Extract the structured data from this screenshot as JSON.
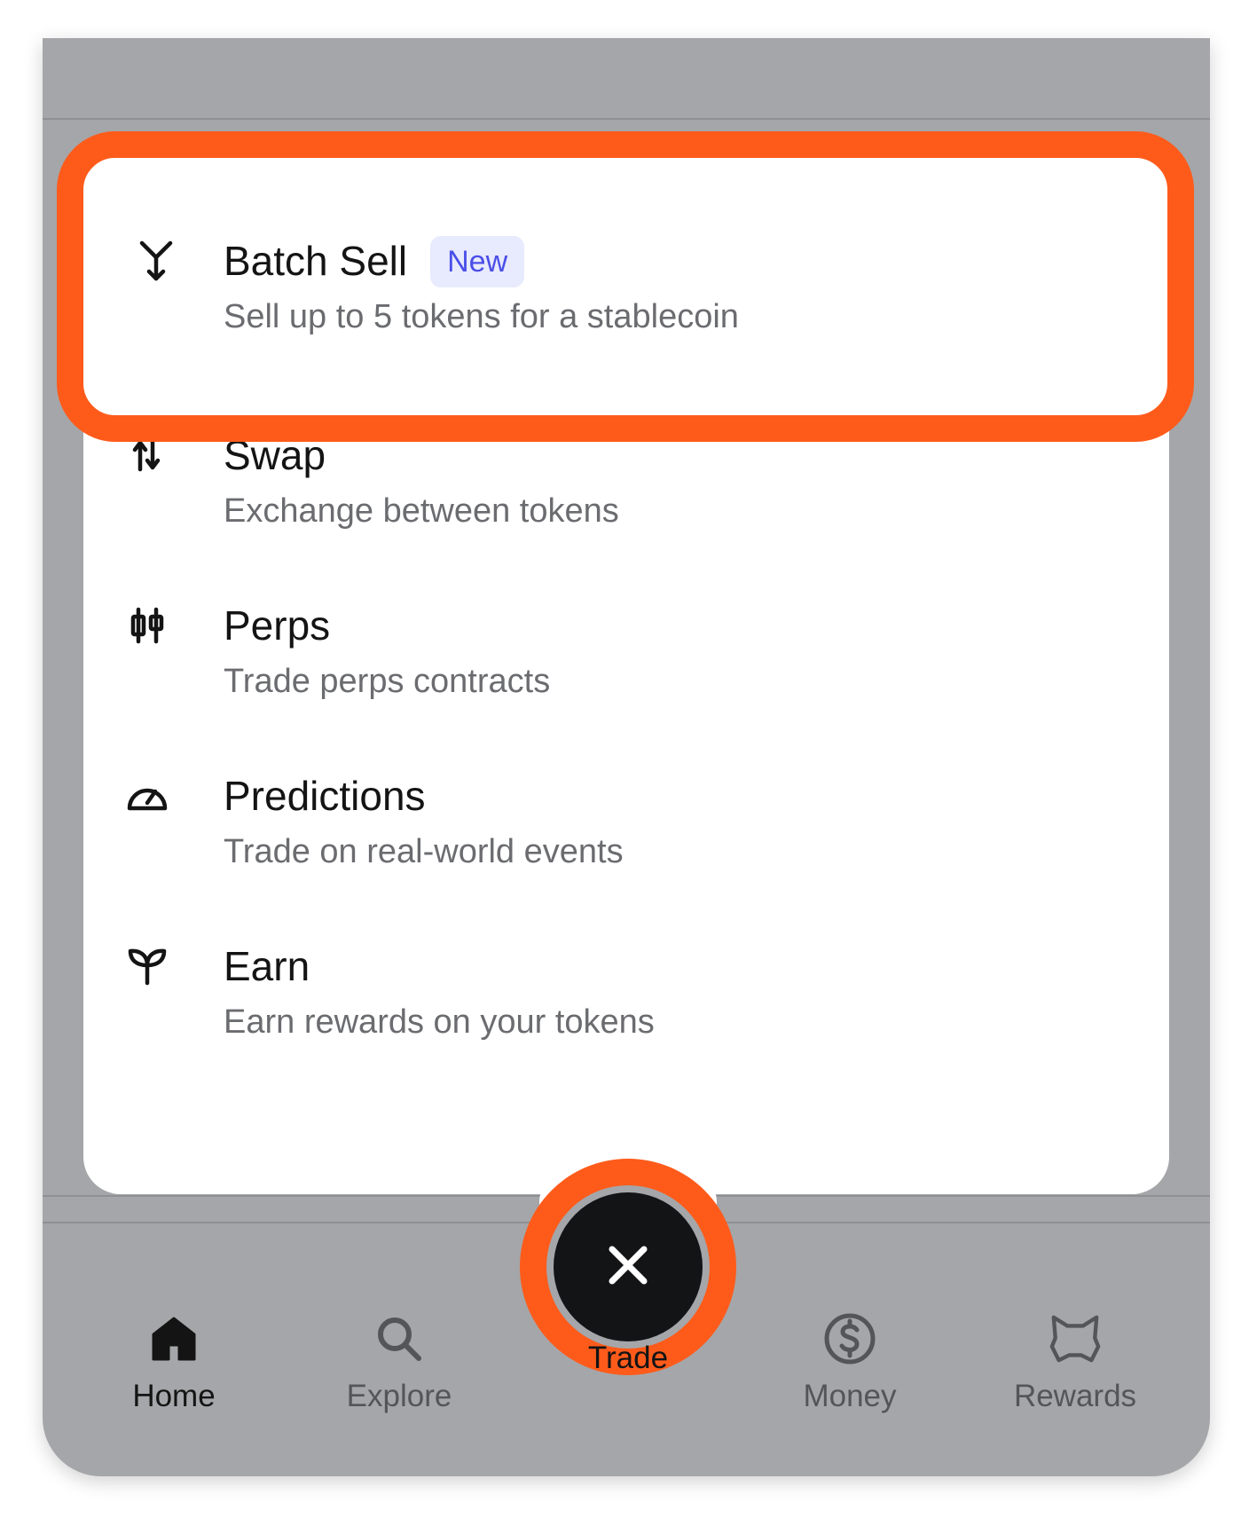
{
  "menu": {
    "items": [
      {
        "id": "batch-sell",
        "title": "Batch Sell",
        "badge": "New",
        "subtitle": "Sell up to 5 tokens for a stablecoin",
        "icon": "merge-arrow-icon"
      },
      {
        "id": "swap",
        "title": "Swap",
        "subtitle": "Exchange between tokens",
        "icon": "swap-arrows-icon"
      },
      {
        "id": "perps",
        "title": "Perps",
        "subtitle": "Trade perps contracts",
        "icon": "candlestick-icon"
      },
      {
        "id": "predictions",
        "title": "Predictions",
        "subtitle": "Trade on real-world events",
        "icon": "gauge-icon"
      },
      {
        "id": "earn",
        "title": "Earn",
        "subtitle": "Earn rewards on your tokens",
        "icon": "sprout-icon"
      }
    ]
  },
  "nav": {
    "items": [
      {
        "label": "Home",
        "icon": "home-icon",
        "active": true
      },
      {
        "label": "Explore",
        "icon": "search-icon",
        "active": false
      },
      {
        "label": "Trade",
        "icon": "close-icon",
        "active": true
      },
      {
        "label": "Money",
        "icon": "dollar-circle-icon",
        "active": false
      },
      {
        "label": "Rewards",
        "icon": "fox-icon",
        "active": false
      }
    ]
  },
  "colors": {
    "highlight": "#fe5b1b",
    "overlay": "#a5a6a9",
    "badge_text": "#4b4fe8",
    "badge_bg": "#e8eafd",
    "trade_button": "#131416"
  }
}
